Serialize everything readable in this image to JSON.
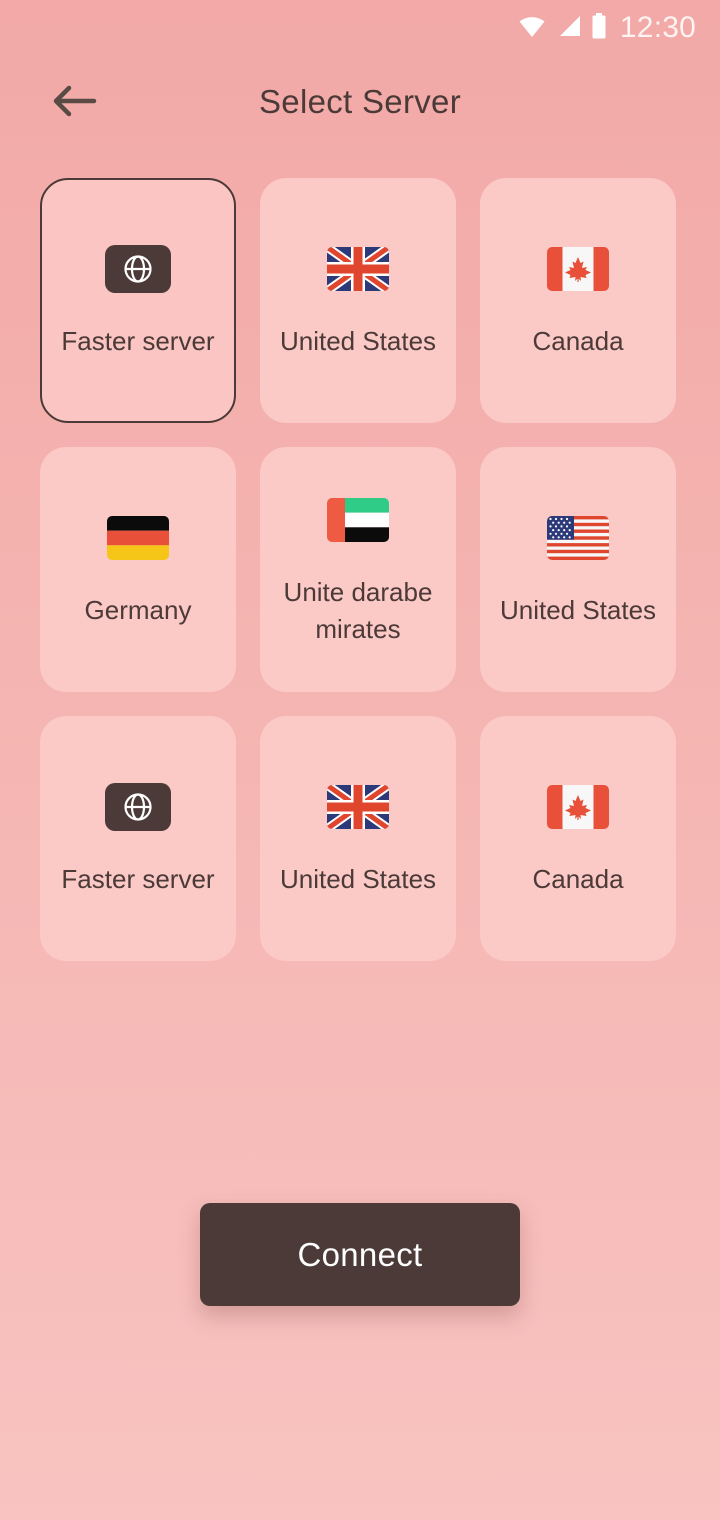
{
  "status_bar": {
    "time": "12:30",
    "icons": [
      "wifi-icon",
      "cellular-signal-icon",
      "battery-icon"
    ]
  },
  "header": {
    "title": "Select Server",
    "back_icon": "arrow-left-icon"
  },
  "servers": [
    {
      "label": "Faster server",
      "icon": "globe-icon",
      "selected": true
    },
    {
      "label": "United States",
      "icon": "flag-uk",
      "selected": false
    },
    {
      "label": "Canada",
      "icon": "flag-canada",
      "selected": false
    },
    {
      "label": "Germany",
      "icon": "flag-germany",
      "selected": false
    },
    {
      "label": "Unite darabe mirates",
      "icon": "flag-uae",
      "selected": false
    },
    {
      "label": "United States",
      "icon": "flag-usa",
      "selected": false
    },
    {
      "label": "Faster server",
      "icon": "globe-icon",
      "selected": false
    },
    {
      "label": "United States",
      "icon": "flag-uk",
      "selected": false
    },
    {
      "label": "Canada",
      "icon": "flag-canada",
      "selected": false
    }
  ],
  "footer": {
    "connect_label": "Connect"
  },
  "colors": {
    "background_top": "#f2a9a7",
    "background_bottom": "#f8c3c0",
    "card": "#fbc9c6",
    "accent_dark": "#4b3a37",
    "text_on_dark": "#ffffff"
  }
}
